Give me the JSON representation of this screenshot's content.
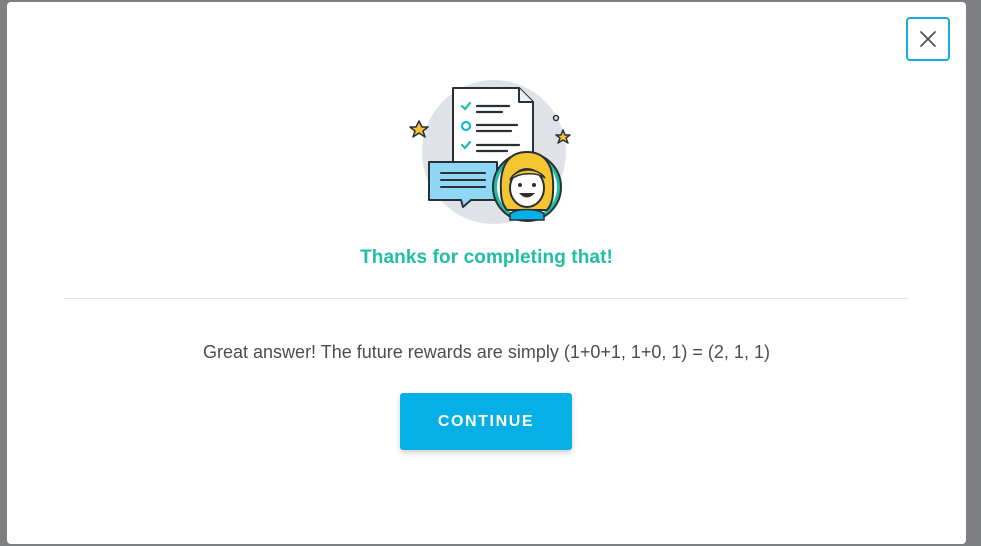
{
  "modal": {
    "close_icon": "close-icon",
    "illustration_icon": "feedback-success-illustration",
    "title": "Thanks for completing that!",
    "message": "Great answer! The future rewards are simply (1+0+1, 1+0, 1) = (2, 1, 1)",
    "continue_label": "CONTINUE"
  },
  "colors": {
    "overlay": "#7d7f82",
    "accent_title": "#1fbfa3",
    "button_bg": "#05b0e6",
    "close_border": "#1aa9e0",
    "text": "#4a4d52"
  }
}
